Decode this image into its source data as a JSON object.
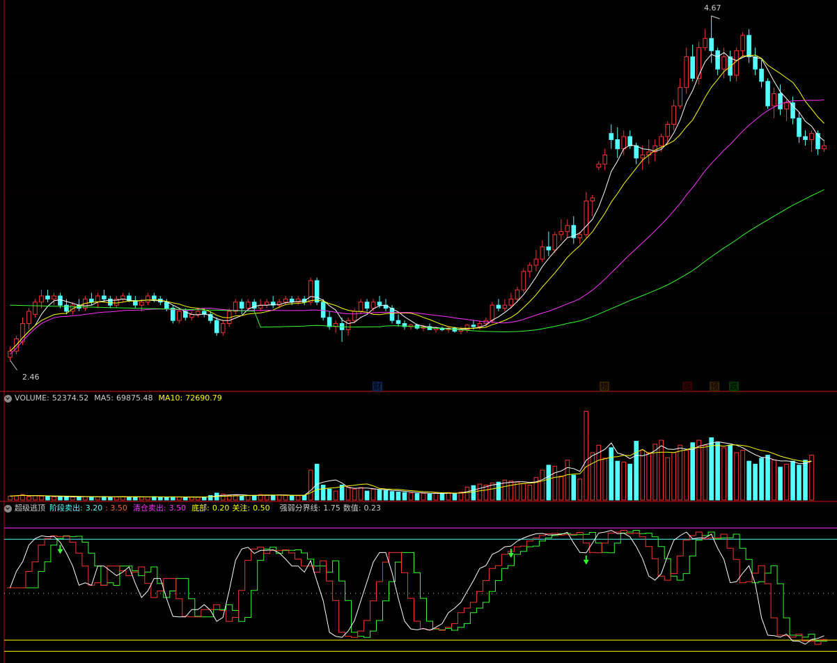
{
  "colors": {
    "up": "#ff3232",
    "down": "#54ffff",
    "ma_white": "#ffffff",
    "ma_yellow": "#ffff00",
    "ma_magenta": "#ff32ff",
    "ma_green": "#32ff32",
    "border": "#b01010",
    "grid": "#3a0000"
  },
  "main": {
    "max_label": "4.67",
    "min_label": "2.46",
    "price_range": [
      2.38,
      4.72
    ],
    "event_tags": [
      {
        "text": "财",
        "color": "#4da6ff"
      },
      {
        "text": "榜",
        "color": "#ff9f40"
      },
      {
        "text": "涨",
        "color": "#ff4444"
      },
      {
        "text": "预",
        "color": "#ff9f40"
      },
      {
        "text": "跌",
        "color": "#32ff32"
      }
    ]
  },
  "volume_panel": {
    "label": "VOLUME:",
    "value": "52374.52",
    "ma5_label": "MA5:",
    "ma5_value": "69875.48",
    "ma10_label": "MA10:",
    "ma10_value": "72690.79",
    "max": 190000
  },
  "indicator_panel": {
    "name": "超级逃顶",
    "stage_sell_label": "阶段卖出:",
    "stage_sell_value": "3.20",
    "stage_sell_value2": ": 3.50",
    "clear_sell_label": "清仓卖出:",
    "clear_sell_value": "3.50",
    "bottom_label": "底部:",
    "bottom_value": "0.20",
    "attention_label": "关注:",
    "attention_value": "0.50",
    "boundary_label": "强弱分界线:",
    "boundary_value": "1.75",
    "number_label": "数值:",
    "number_value": "0.23",
    "range": [
      0,
      3.8
    ]
  },
  "chart_data": {
    "type": "candlestick",
    "min_price": 2.46,
    "max_price": 4.67,
    "candles": [
      [
        2.48,
        2.55,
        2.46,
        2.52
      ],
      [
        2.52,
        2.62,
        2.5,
        2.6
      ],
      [
        2.58,
        2.74,
        2.56,
        2.7
      ],
      [
        2.7,
        2.8,
        2.66,
        2.78
      ],
      [
        2.76,
        2.86,
        2.74,
        2.84
      ],
      [
        2.84,
        2.92,
        2.8,
        2.88
      ],
      [
        2.88,
        2.92,
        2.84,
        2.86
      ],
      [
        2.86,
        2.9,
        2.82,
        2.88
      ],
      [
        2.88,
        2.9,
        2.8,
        2.82
      ],
      [
        2.82,
        2.86,
        2.76,
        2.78
      ],
      [
        2.78,
        2.84,
        2.76,
        2.82
      ],
      [
        2.82,
        2.86,
        2.78,
        2.8
      ],
      [
        2.8,
        2.88,
        2.78,
        2.86
      ],
      [
        2.86,
        2.9,
        2.82,
        2.84
      ],
      [
        2.84,
        2.9,
        2.8,
        2.88
      ],
      [
        2.88,
        2.92,
        2.84,
        2.86
      ],
      [
        2.86,
        2.88,
        2.8,
        2.82
      ],
      [
        2.82,
        2.88,
        2.8,
        2.86
      ],
      [
        2.86,
        2.9,
        2.84,
        2.88
      ],
      [
        2.88,
        2.9,
        2.84,
        2.85
      ],
      [
        2.85,
        2.88,
        2.8,
        2.82
      ],
      [
        2.82,
        2.86,
        2.78,
        2.84
      ],
      [
        2.84,
        2.9,
        2.82,
        2.88
      ],
      [
        2.88,
        2.9,
        2.84,
        2.86
      ],
      [
        2.86,
        2.88,
        2.82,
        2.84
      ],
      [
        2.84,
        2.86,
        2.78,
        2.8
      ],
      [
        2.8,
        2.82,
        2.7,
        2.72
      ],
      [
        2.72,
        2.8,
        2.7,
        2.78
      ],
      [
        2.78,
        2.8,
        2.72,
        2.74
      ],
      [
        2.74,
        2.78,
        2.72,
        2.76
      ],
      [
        2.76,
        2.8,
        2.74,
        2.78
      ],
      [
        2.78,
        2.8,
        2.74,
        2.76
      ],
      [
        2.76,
        2.78,
        2.7,
        2.72
      ],
      [
        2.72,
        2.74,
        2.62,
        2.64
      ],
      [
        2.64,
        2.72,
        2.62,
        2.7
      ],
      [
        2.7,
        2.8,
        2.68,
        2.78
      ],
      [
        2.78,
        2.86,
        2.76,
        2.84
      ],
      [
        2.84,
        2.86,
        2.76,
        2.8
      ],
      [
        2.8,
        2.86,
        2.78,
        2.84
      ],
      [
        2.84,
        2.86,
        2.78,
        2.8
      ],
      [
        2.8,
        2.86,
        2.78,
        2.82
      ],
      [
        2.82,
        2.86,
        2.8,
        2.84
      ],
      [
        2.84,
        2.88,
        2.8,
        2.82
      ],
      [
        2.82,
        2.86,
        2.8,
        2.84
      ],
      [
        2.84,
        2.88,
        2.82,
        2.86
      ],
      [
        2.86,
        2.88,
        2.82,
        2.84
      ],
      [
        2.84,
        2.88,
        2.82,
        2.86
      ],
      [
        2.86,
        2.88,
        2.82,
        2.84
      ],
      [
        2.84,
        3.0,
        2.82,
        2.98
      ],
      [
        2.98,
        3.0,
        2.82,
        2.84
      ],
      [
        2.84,
        2.86,
        2.72,
        2.74
      ],
      [
        2.74,
        2.78,
        2.66,
        2.68
      ],
      [
        2.68,
        2.72,
        2.64,
        2.7
      ],
      [
        2.7,
        2.74,
        2.58,
        2.66
      ],
      [
        2.66,
        2.74,
        2.62,
        2.72
      ],
      [
        2.72,
        2.8,
        2.7,
        2.78
      ],
      [
        2.78,
        2.86,
        2.76,
        2.84
      ],
      [
        2.84,
        2.86,
        2.78,
        2.8
      ],
      [
        2.8,
        2.86,
        2.78,
        2.84
      ],
      [
        2.84,
        2.88,
        2.8,
        2.82
      ],
      [
        2.82,
        2.86,
        2.78,
        2.8
      ],
      [
        2.8,
        2.82,
        2.7,
        2.72
      ],
      [
        2.72,
        2.76,
        2.68,
        2.7
      ],
      [
        2.7,
        2.72,
        2.66,
        2.68
      ],
      [
        2.68,
        2.7,
        2.66,
        2.69
      ],
      [
        2.69,
        2.7,
        2.66,
        2.67
      ],
      [
        2.67,
        2.69,
        2.65,
        2.68
      ],
      [
        2.68,
        2.7,
        2.66,
        2.66
      ],
      [
        2.66,
        2.68,
        2.64,
        2.67
      ],
      [
        2.67,
        2.68,
        2.65,
        2.66
      ],
      [
        2.66,
        2.68,
        2.64,
        2.67
      ],
      [
        2.67,
        2.68,
        2.64,
        2.65
      ],
      [
        2.65,
        2.68,
        2.63,
        2.66
      ],
      [
        2.66,
        2.7,
        2.64,
        2.69
      ],
      [
        2.69,
        2.72,
        2.66,
        2.68
      ],
      [
        2.68,
        2.72,
        2.66,
        2.7
      ],
      [
        2.7,
        2.74,
        2.68,
        2.72
      ],
      [
        2.72,
        2.84,
        2.7,
        2.82
      ],
      [
        2.82,
        2.86,
        2.78,
        2.8
      ],
      [
        2.8,
        2.86,
        2.78,
        2.82
      ],
      [
        2.82,
        2.9,
        2.8,
        2.86
      ],
      [
        2.86,
        2.94,
        2.84,
        2.92
      ],
      [
        2.92,
        3.06,
        2.9,
        3.04
      ],
      [
        3.04,
        3.1,
        3.0,
        3.08
      ],
      [
        3.08,
        3.18,
        3.04,
        3.12
      ],
      [
        3.12,
        3.24,
        3.1,
        3.2
      ],
      [
        3.2,
        3.3,
        3.14,
        3.18
      ],
      [
        3.18,
        3.3,
        3.16,
        3.28
      ],
      [
        3.28,
        3.38,
        3.24,
        3.3
      ],
      [
        3.3,
        3.38,
        3.26,
        3.34
      ],
      [
        3.34,
        3.4,
        3.22,
        3.26
      ],
      [
        3.26,
        3.3,
        3.22,
        3.28
      ],
      [
        3.28,
        3.56,
        3.26,
        3.5
      ],
      [
        3.5,
        3.54,
        3.4,
        3.52
      ],
      [
        3.72,
        3.76,
        3.7,
        3.74
      ],
      [
        3.74,
        3.84,
        3.7,
        3.8
      ],
      [
        3.94,
        4.0,
        3.84,
        3.9
      ],
      [
        3.9,
        3.98,
        3.78,
        3.84
      ],
      [
        3.84,
        3.96,
        3.8,
        3.92
      ],
      [
        3.92,
        3.96,
        3.84,
        3.86
      ],
      [
        3.86,
        3.88,
        3.74,
        3.78
      ],
      [
        3.78,
        3.86,
        3.7,
        3.8
      ],
      [
        3.8,
        3.9,
        3.74,
        3.82
      ],
      [
        3.82,
        3.9,
        3.76,
        3.86
      ],
      [
        3.86,
        3.94,
        3.82,
        3.92
      ],
      [
        3.92,
        4.02,
        3.88,
        4.0
      ],
      [
        4.0,
        4.16,
        3.96,
        4.12
      ],
      [
        4.12,
        4.3,
        4.1,
        4.24
      ],
      [
        4.24,
        4.5,
        4.2,
        4.44
      ],
      [
        4.44,
        4.52,
        4.28,
        4.3
      ],
      [
        4.3,
        4.54,
        4.26,
        4.5
      ],
      [
        4.5,
        4.62,
        4.48,
        4.56
      ],
      [
        4.56,
        4.67,
        4.4,
        4.48
      ],
      [
        4.48,
        4.5,
        4.32,
        4.36
      ],
      [
        4.36,
        4.5,
        4.3,
        4.44
      ],
      [
        4.44,
        4.48,
        4.28,
        4.32
      ],
      [
        4.32,
        4.5,
        4.28,
        4.48
      ],
      [
        4.48,
        4.6,
        4.44,
        4.58
      ],
      [
        4.58,
        4.62,
        4.4,
        4.44
      ],
      [
        4.44,
        4.5,
        4.32,
        4.36
      ],
      [
        4.36,
        4.42,
        4.24,
        4.28
      ],
      [
        4.28,
        4.3,
        4.1,
        4.12
      ],
      [
        4.12,
        4.24,
        4.04,
        4.2
      ],
      [
        4.2,
        4.26,
        4.06,
        4.1
      ],
      [
        4.1,
        4.16,
        4.02,
        4.14
      ],
      [
        4.14,
        4.18,
        4.0,
        4.04
      ],
      [
        4.04,
        4.08,
        3.88,
        3.92
      ],
      [
        3.92,
        3.96,
        3.86,
        3.9
      ],
      [
        3.9,
        3.96,
        3.82,
        3.94
      ],
      [
        3.94,
        3.96,
        3.8,
        3.84
      ],
      [
        3.84,
        3.9,
        3.82,
        3.86
      ]
    ],
    "volume": [
      8000,
      9000,
      11000,
      7000,
      9000,
      8000,
      7000,
      6500,
      6000,
      7000,
      6000,
      6500,
      7000,
      6000,
      6500,
      7000,
      6000,
      6500,
      7000,
      6000,
      6500,
      6000,
      6200,
      6800,
      6000,
      5800,
      6500,
      6000,
      5500,
      6000,
      5800,
      6200,
      9000,
      14000,
      12000,
      9000,
      10000,
      8000,
      9000,
      9500,
      11000,
      10000,
      9000,
      10500,
      9500,
      9000,
      8500,
      9000,
      60000,
      72000,
      30000,
      22000,
      18000,
      30000,
      26000,
      22000,
      25000,
      18000,
      22000,
      20000,
      19000,
      17000,
      16000,
      15000,
      14000,
      13000,
      13500,
      12000,
      14500,
      13000,
      15000,
      14000,
      16000,
      26000,
      29000,
      32000,
      30000,
      34000,
      36000,
      40000,
      38000,
      36000,
      33000,
      30000,
      45000,
      60000,
      70000,
      68000,
      48000,
      80000,
      50000,
      42000,
      178000,
      95000,
      110000,
      84000,
      105000,
      78000,
      76000,
      72000,
      118000,
      100000,
      95000,
      112000,
      120000,
      85000,
      95000,
      110000,
      100000,
      115000,
      120000,
      110000,
      125000,
      115000,
      105000,
      110000,
      95000,
      100000,
      78000,
      72000,
      84000,
      90000,
      80000,
      66000,
      72000,
      78000,
      70000,
      80000,
      90000
    ]
  }
}
